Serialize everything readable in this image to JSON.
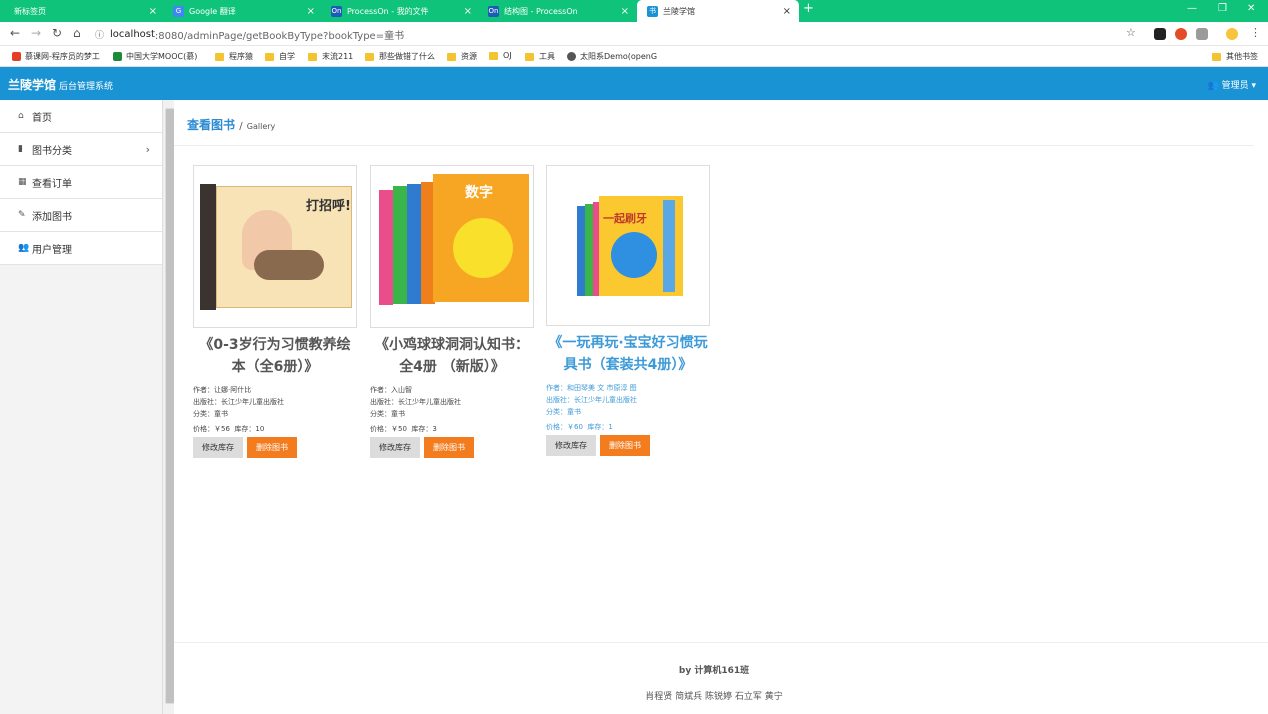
{
  "browser": {
    "tabs": [
      {
        "label": "新标签页"
      },
      {
        "label": "Google 翻译"
      },
      {
        "label": "ProcessOn - 我的文件"
      },
      {
        "label": "结构图 - ProcessOn"
      },
      {
        "label": "兰陵学馆"
      }
    ],
    "url_host": "localhost",
    "url_path": ":8080/adminPage/getBookByType?bookType=童书",
    "bookmarks": [
      "慕课网-程序员的梦工",
      "中国大学MOOC(慕)",
      "程序猿",
      "自学",
      "末流211",
      "那些做错了什么",
      "资源",
      "OJ",
      "工具",
      "太阳系Demo(openG"
    ],
    "other_bookmarks": "其他书签"
  },
  "header": {
    "brand": "兰陵学馆",
    "subtitle": "后台管理系统",
    "admin_label": "管理员"
  },
  "sidebar": {
    "items": [
      {
        "label": "首页"
      },
      {
        "label": "图书分类"
      },
      {
        "label": "查看订单"
      },
      {
        "label": "添加图书"
      },
      {
        "label": "用户管理"
      }
    ]
  },
  "page": {
    "title": "查看图书",
    "separator": "/",
    "subtitle": "Gallery"
  },
  "labels": {
    "author": "作者：",
    "publisher": "出版社：",
    "category": "分类：",
    "price": "价格：",
    "stock": "库存：",
    "edit_stock": "修改库存",
    "delete_book": "删除图书"
  },
  "books": [
    {
      "title": "《0-3岁行为习惯教养绘本（全6册）》",
      "author": "让娜·阿什比",
      "publisher": "长江少年儿童出版社",
      "category": "童书",
      "price": "￥56",
      "stock": "10",
      "cover_text": "打招呼!"
    },
    {
      "title": "《小鸡球球洞洞认知书：全4册 （新版）》",
      "author": "入山智",
      "publisher": "长江少年儿童出版社",
      "category": "童书",
      "price": "￥50",
      "stock": "3",
      "cover_text": "数字"
    },
    {
      "title": "《一玩再玩·宝宝好习惯玩具书（套装共4册）》",
      "author": "和田琴美 文 市原淳 图",
      "publisher": "长江少年儿童出版社",
      "category": "童书",
      "price": "￥60",
      "stock": "1",
      "cover_text": "一起刷牙"
    }
  ],
  "footer": {
    "by": "by 计算机161班",
    "names": "肖程贤 简斌兵 陈锐婷 石立军 黄宁"
  },
  "colors": {
    "header": "#1a93d4",
    "accent": "#2a8bd3",
    "delete": "#f37c1f",
    "tabstrip": "#0fc37a"
  }
}
